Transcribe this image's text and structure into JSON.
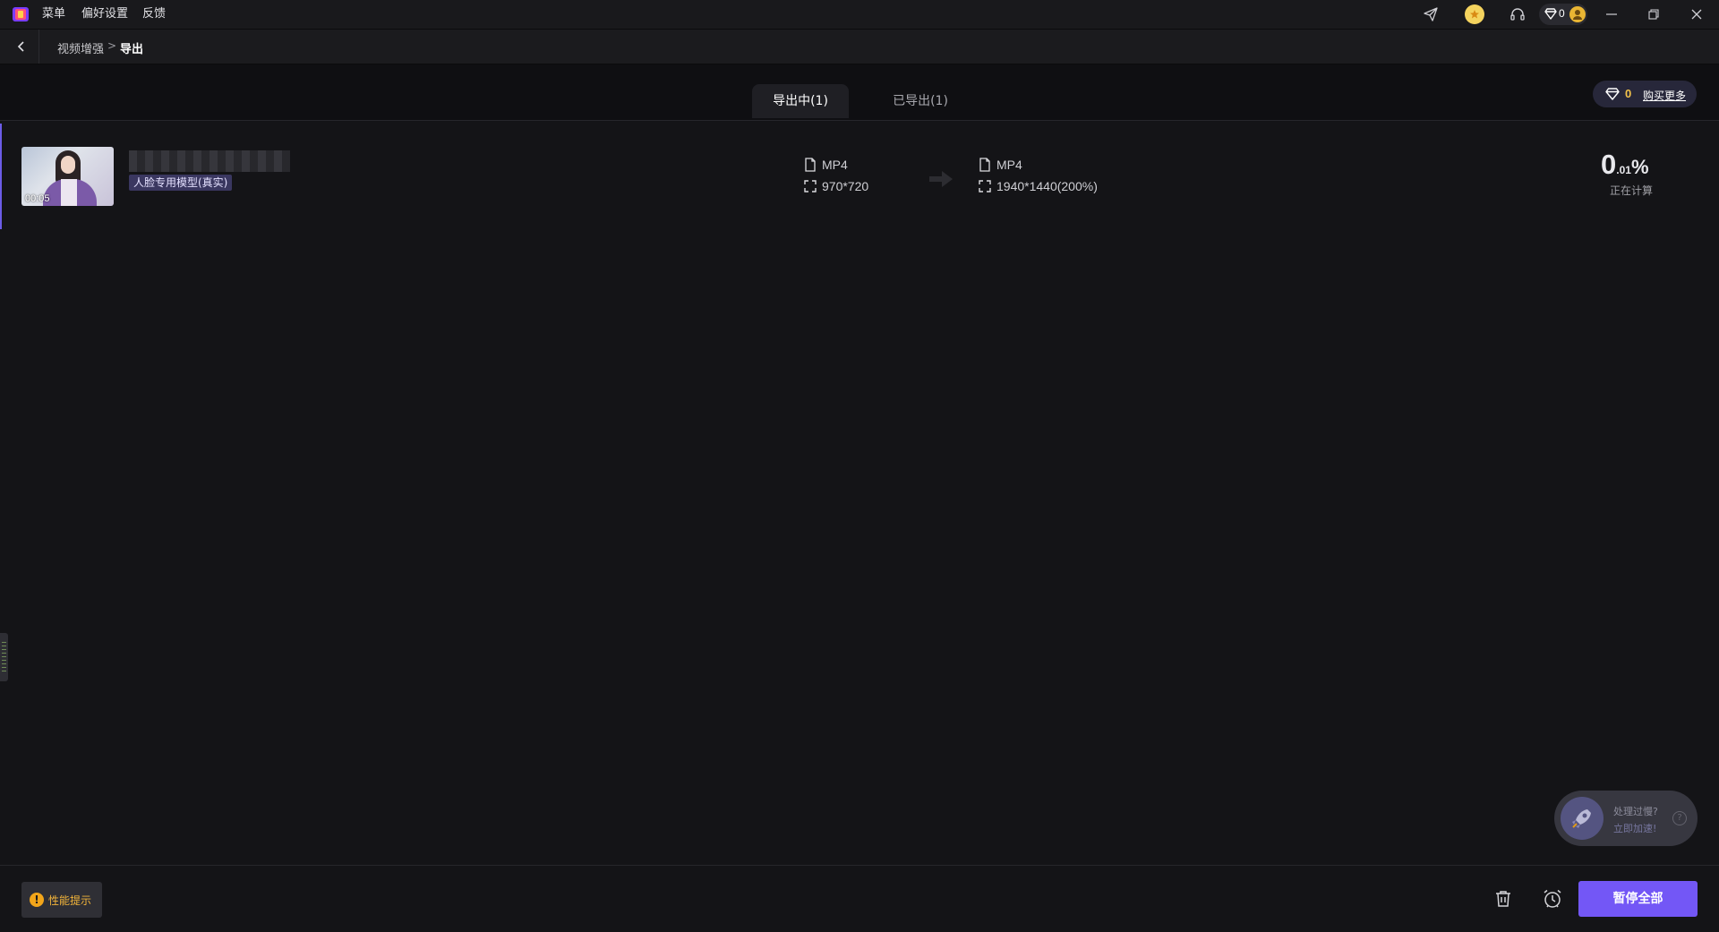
{
  "titlebar": {
    "menu": [
      "菜单",
      "偏好设置",
      "反馈"
    ],
    "gem_count": "0",
    "icons": [
      "send-icon",
      "coin-icon",
      "headset-icon",
      "diamond-icon",
      "avatar-icon",
      "minimize-icon",
      "restore-icon",
      "close-icon"
    ]
  },
  "breadcrumb": {
    "parent": "视频增强",
    "separator": ">",
    "current": "导出"
  },
  "tabs": [
    {
      "label": "导出中(1)",
      "active": true
    },
    {
      "label": "已导出(1)",
      "active": false
    }
  ],
  "buy_more": {
    "count": "0",
    "label": "购买更多"
  },
  "export_item": {
    "duration": "00:05",
    "model_tag": "人脸专用模型(真实)",
    "source": {
      "format": "MP4",
      "resolution": "970*720"
    },
    "target": {
      "format": "MP4",
      "resolution": "1940*1440(200%)"
    },
    "progress": {
      "whole": "0",
      "fraction": ".01",
      "unit": "%"
    },
    "status": "正在计算"
  },
  "float_widget": {
    "line1": "处理过慢?",
    "line2": "立即加速!",
    "help": "?"
  },
  "bottom": {
    "perf_tip": "性能提示",
    "pause_all": "暂停全部"
  },
  "colors": {
    "accent": "#7357f6",
    "warning": "#f2a51a",
    "gem": "#f3c24a",
    "tag_bg": "#3a3760"
  }
}
